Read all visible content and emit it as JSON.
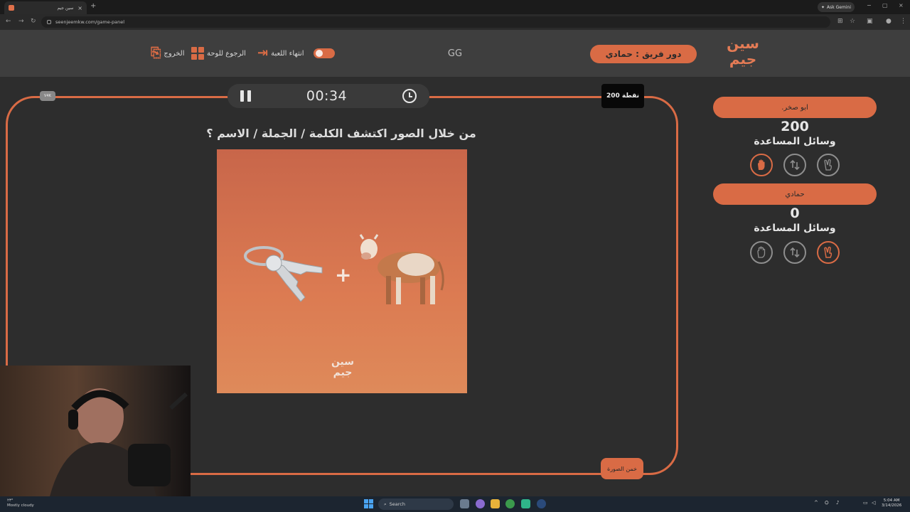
{
  "browser": {
    "tab_title": "سين جيم",
    "tab_close": "×",
    "new_tab": "+",
    "ask_gemini": "Ask Gemini",
    "url": "seenjeemkw.com/game-panel",
    "min": "−",
    "restore": "▢",
    "close": "×"
  },
  "header": {
    "logo": "سين جيم",
    "turn_label": "دور فريق : حمادي",
    "gg": "GG",
    "end_game": "انتهاء اللعبة",
    "back_to_board": "الرجوع للوحة",
    "exit": "الخروج"
  },
  "game": {
    "timer": "00:34",
    "points": "200 نقطة",
    "corner_badge": "V4K",
    "question": "من خلال الصور اكتشف الكلمة / الجملة / الاسم ؟",
    "plus": "+",
    "puzzle_logo": "سين جيم",
    "hint_button": "خمن الصورة"
  },
  "teams": [
    {
      "name": ".ابو صخر",
      "score": "200",
      "tools_label": "وسائل المساعدة",
      "active_help": "stop-hand-icon"
    },
    {
      "name": "حمادي",
      "score": "0",
      "tools_label": "وسائل المساعدة",
      "active_help": "two-fingers-icon"
    }
  ],
  "taskbar": {
    "weather_temp": "٢٣°",
    "weather_text": "Mostly cloudy",
    "search": "Search",
    "time": "5:04 AM",
    "date": "3/14/2026"
  },
  "colors": {
    "accent": "#d96b45",
    "header_bg": "#3e3e3e",
    "main_bg": "#2d2d2d"
  }
}
